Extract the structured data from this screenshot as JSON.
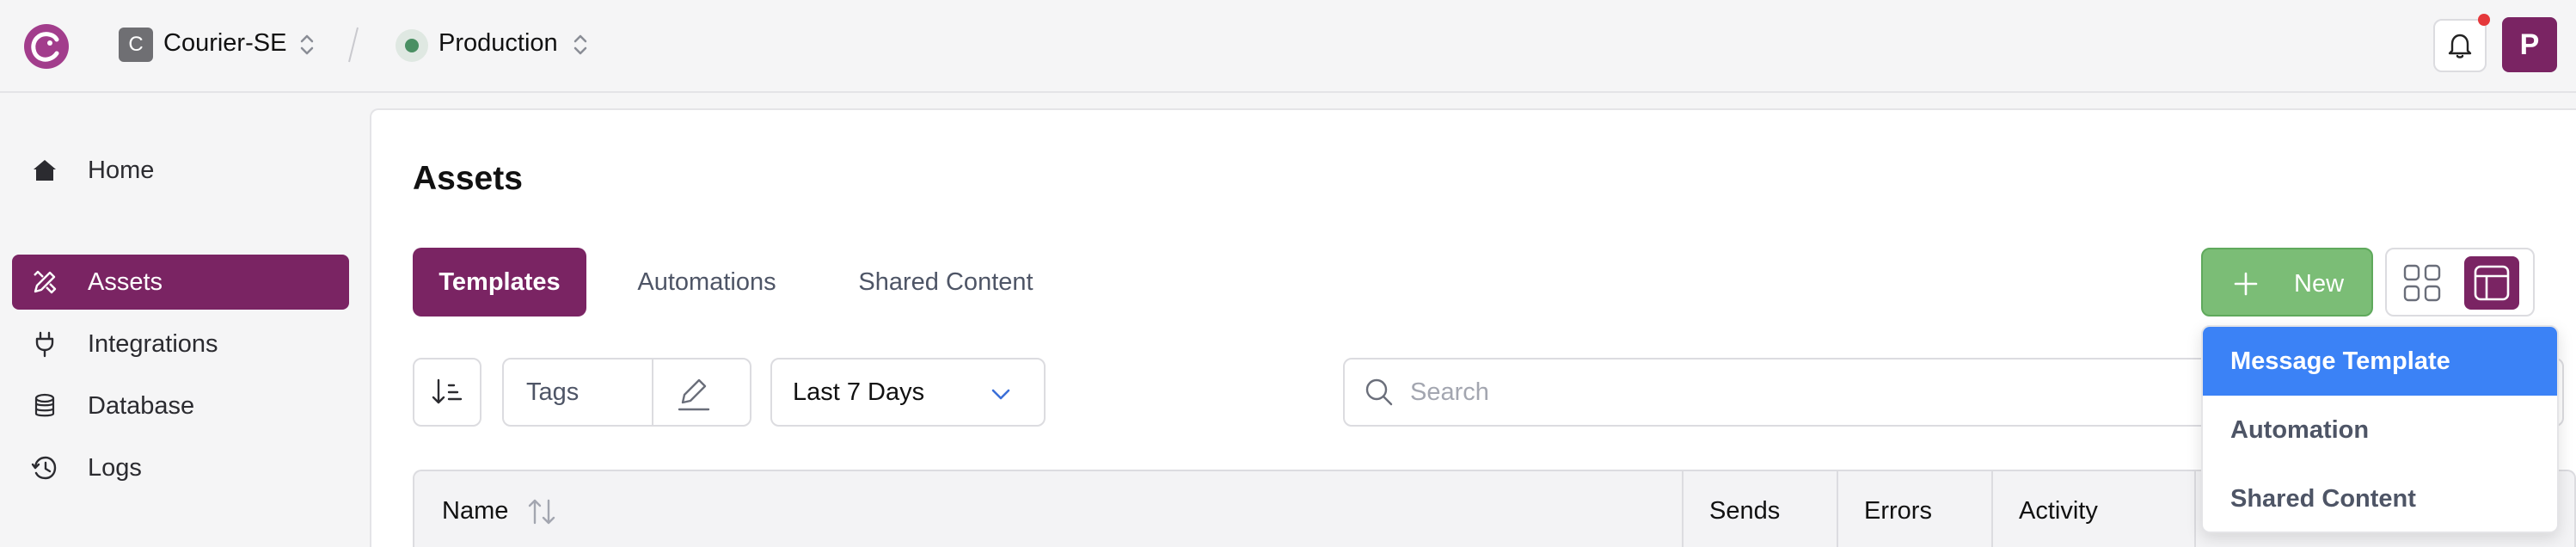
{
  "topbar": {
    "workspace_initial": "C",
    "workspace_name": "Courier-SE",
    "environment_name": "Production",
    "environment_color": "#4a8f63",
    "avatar_initial": "P",
    "avatar_color": "#7a2463",
    "notification_badge_color": "#e5383b"
  },
  "sidebar": {
    "items": [
      {
        "label": "Home",
        "icon": "home-icon"
      },
      {
        "label": "Assets",
        "icon": "pen-ruler-icon",
        "active": true
      },
      {
        "label": "Integrations",
        "icon": "plug-icon"
      },
      {
        "label": "Database",
        "icon": "database-icon"
      },
      {
        "label": "Logs",
        "icon": "history-icon"
      }
    ]
  },
  "main": {
    "title": "Assets",
    "tabs": [
      {
        "label": "Templates",
        "active": true
      },
      {
        "label": "Automations"
      },
      {
        "label": "Shared Content"
      }
    ],
    "new_button_label": "New",
    "filters": {
      "tags_label": "Tags",
      "date_range": "Last 7 Days",
      "search_placeholder": "Search",
      "search_value": ""
    },
    "table": {
      "columns": [
        "Name",
        "Sends",
        "Errors",
        "Activity"
      ]
    },
    "new_menu": {
      "items": [
        {
          "label": "Message Template",
          "highlighted": true
        },
        {
          "label": "Automation"
        },
        {
          "label": "Shared Content"
        }
      ]
    }
  },
  "colors": {
    "brand": "#7a2463",
    "new_button": "#7bbd76",
    "menu_highlight": "#3b82f6"
  }
}
